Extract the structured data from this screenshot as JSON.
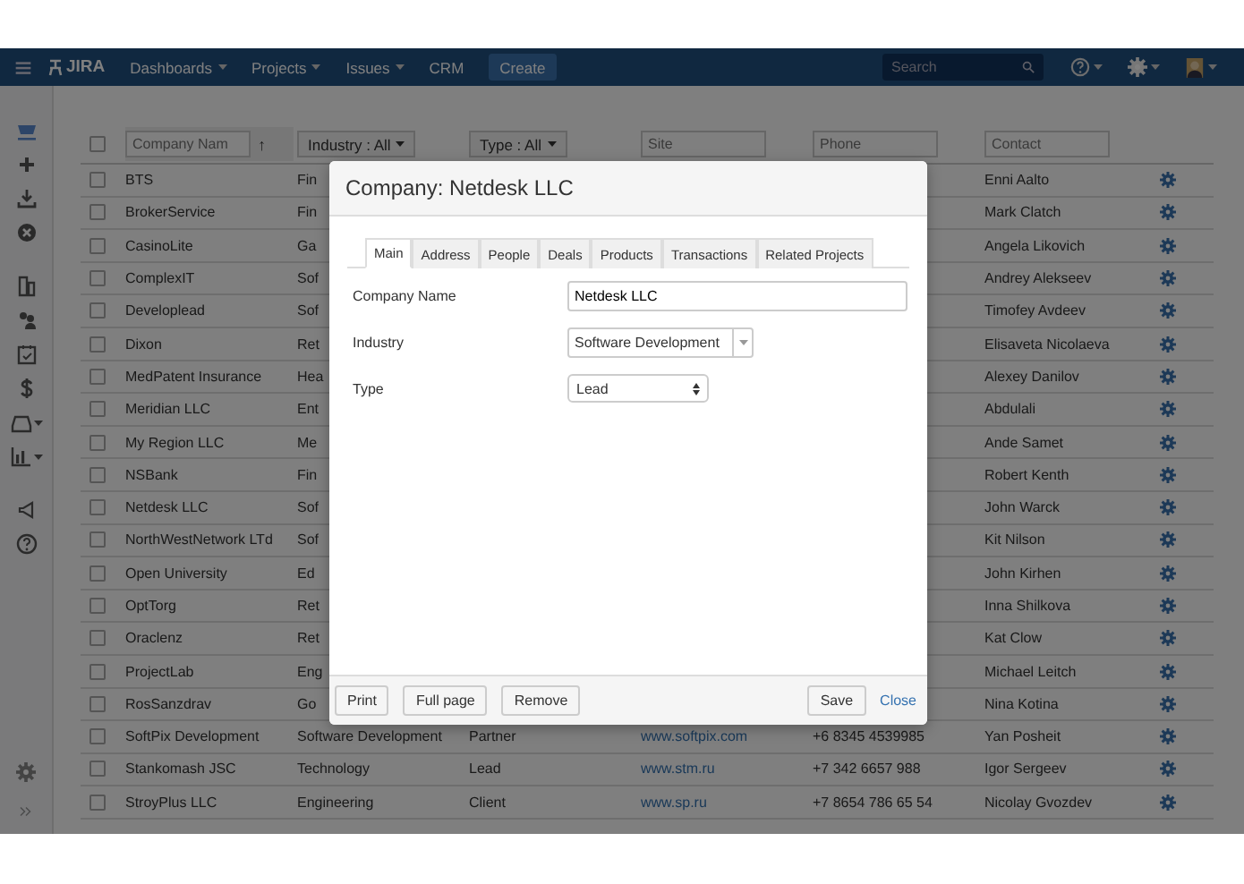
{
  "navbar": {
    "logo": "JIRA",
    "menu": [
      {
        "label": "Dashboards",
        "dropdown": true
      },
      {
        "label": "Projects",
        "dropdown": true
      },
      {
        "label": "Issues",
        "dropdown": true
      },
      {
        "label": "CRM",
        "dropdown": false
      }
    ],
    "create": "Create",
    "search": {
      "placeholder": "Search"
    }
  },
  "table": {
    "select_all": {
      "checked": false
    },
    "filters": [
      {
        "kind": "input",
        "placeholder": "Company Nam",
        "sort": "↑"
      },
      {
        "kind": "dropdown",
        "label": "Industry : All"
      },
      {
        "kind": "dropdown",
        "label": "Type : All"
      },
      {
        "kind": "input",
        "placeholder": "Site"
      },
      {
        "kind": "input",
        "placeholder": "Phone"
      },
      {
        "kind": "input",
        "placeholder": "Contact"
      }
    ],
    "rows": [
      {
        "checked": false,
        "name": "BTS",
        "industry": "Fin",
        "contact": "Enni Aalto"
      },
      {
        "checked": false,
        "name": "BrokerService",
        "industry": "Fin",
        "contact": "Mark Clatch"
      },
      {
        "checked": false,
        "name": "CasinoLite",
        "industry": "Ga",
        "contact": "Angela Likovich"
      },
      {
        "checked": false,
        "name": "ComplexIT",
        "industry": "Sof",
        "contact": "Andrey Alekseev"
      },
      {
        "checked": false,
        "name": "Developlead",
        "industry": "Sof",
        "contact": "Timofey Avdeev"
      },
      {
        "checked": false,
        "name": "Dixon",
        "industry": "Ret",
        "contact": "Elisaveta Nicolaeva"
      },
      {
        "checked": false,
        "name": "MedPatent Insurance",
        "industry": "Hea",
        "contact": "Alexey Danilov"
      },
      {
        "checked": false,
        "name": "Meridian LLC",
        "industry": "Ent",
        "contact": "Abdulali"
      },
      {
        "checked": false,
        "name": "My Region LLC",
        "industry": "Me",
        "contact": "Ande Samet"
      },
      {
        "checked": false,
        "name": "NSBank",
        "industry": "Fin",
        "contact": "Robert Kenth"
      },
      {
        "checked": false,
        "name": "Netdesk LLC",
        "industry": "Sof",
        "contact": "John Warck"
      },
      {
        "checked": false,
        "name": "NorthWestNetwork LTd",
        "industry": "Sof",
        "contact": "Kit Nilson"
      },
      {
        "checked": false,
        "name": "Open University",
        "industry": "Ed",
        "contact": "John Kirhen"
      },
      {
        "checked": false,
        "name": "OptTorg",
        "industry": "Ret",
        "contact": "Inna Shilkova"
      },
      {
        "checked": false,
        "name": "Oraclenz",
        "industry": "Ret",
        "contact": "Kat Clow"
      },
      {
        "checked": false,
        "name": "ProjectLab",
        "industry": "Eng",
        "contact": "Michael Leitch"
      },
      {
        "checked": false,
        "name": "RosSanzdrav",
        "industry": "Go",
        "contact": "Nina Kotina"
      },
      {
        "checked": false,
        "name": "SoftPix Development",
        "industry": "Software Development",
        "type": "Partner",
        "site": "www.softpix.com",
        "phone": "+6 8345 4539985",
        "contact": "Yan Posheit"
      },
      {
        "checked": false,
        "name": "Stankomash JSC",
        "industry": "Technology",
        "type": "Lead",
        "site": "www.stm.ru",
        "phone": "+7 342 6657 988",
        "contact": "Igor Sergeev"
      },
      {
        "checked": false,
        "name": "StroyPlus LLC",
        "industry": "Engineering",
        "type": "Client",
        "site": "www.sp.ru",
        "phone": "+7 8654 786 65 54",
        "contact": "Nicolay Gvozdev"
      }
    ]
  },
  "modal": {
    "title": "Company: Netdesk LLC",
    "tabs": [
      {
        "label": "Main",
        "selected": true
      },
      {
        "label": "Address",
        "selected": false
      },
      {
        "label": "People",
        "selected": false
      },
      {
        "label": "Deals",
        "selected": false
      },
      {
        "label": "Products",
        "selected": false
      },
      {
        "label": "Transactions",
        "selected": false
      },
      {
        "label": "Related Projects",
        "selected": false
      }
    ],
    "fields": [
      {
        "kind": "text",
        "label": "Company Name",
        "value": "Netdesk LLC"
      },
      {
        "kind": "combo",
        "label": "Industry",
        "value": "Software Development"
      },
      {
        "kind": "select",
        "label": "Type",
        "value": "Lead"
      }
    ],
    "buttons": [
      "Print",
      "Full page",
      "Remove"
    ],
    "save": "Save",
    "close": "Close"
  }
}
